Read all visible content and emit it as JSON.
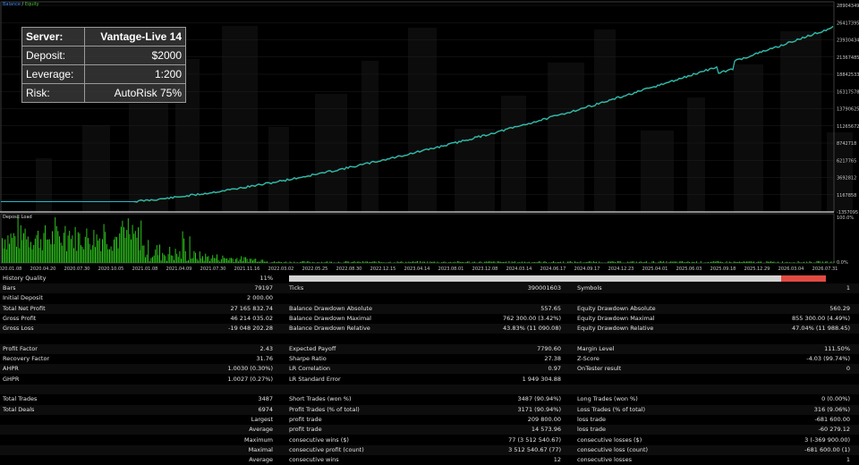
{
  "legend": {
    "balance": "Balance",
    "sep": " / ",
    "equity": "Equity"
  },
  "info_box": {
    "server_label": "Server:",
    "server_value": "Vantage-Live 14",
    "deposit_label": "Deposit:",
    "deposit_value": "$2000",
    "leverage_label": "Leverage:",
    "leverage_value": "1:200",
    "risk_label": "Risk:",
    "risk_value": "AutoRisk 75%"
  },
  "chart": {
    "y_ticks": [
      "28904349",
      "26417395",
      "23930434",
      "21367485",
      "18842533",
      "16317578",
      "13790625",
      "11265672",
      "8742718",
      "6217765",
      "3692812",
      "1167858",
      "-1357095"
    ],
    "load_label": "Deposit Load",
    "load_ticks": [
      "100.0%",
      "0.0%"
    ],
    "x_ticks": [
      "2020.01.08",
      "2020.04.20",
      "2020.07.30",
      "2020.10.05",
      "2021.01.08",
      "2021.04.09",
      "2021.07.30",
      "2021.11.16",
      "2022.03.02",
      "2022.05.25",
      "2022.08.30",
      "2022.12.15",
      "2023.04.14",
      "2023.08.01",
      "2023.12.08",
      "2024.03.14",
      "2024.06.17",
      "2024.09.17",
      "2024.12.23",
      "2025.04.01",
      "2025.06.03",
      "2025.09.18",
      "2025.12.29",
      "2026.03.04",
      "2026.07.31"
    ],
    "colors": {
      "balance": "#3d8cff",
      "equity": "#4bbf3b",
      "load": "#2ec21d",
      "grid": "#1e1e1e",
      "axis": "#c8c8c8"
    }
  },
  "stats": {
    "history_quality_label": "History Quality",
    "history_quality_value": "11%",
    "history_quality_bad_fraction": 0.083,
    "rows": [
      {
        "l1": "Bars",
        "v1": "79197",
        "l2": "Ticks",
        "v2": "390001603",
        "l3": "Symbols",
        "v3": "1"
      },
      {
        "l1": "Initial Deposit",
        "v1": "2 000.00",
        "l2": "",
        "v2": "",
        "l3": "",
        "v3": ""
      },
      {
        "l1": "Total Net Profit",
        "v1": "27 165 832.74",
        "l2": "Balance Drawdown Absolute",
        "v2": "557.65",
        "l3": "Equity Drawdown Absolute",
        "v3": "560.29"
      },
      {
        "l1": "Gross Profit",
        "v1": "46 214 035.02",
        "l2": "Balance Drawdown Maximal",
        "v2": "762 300.00 (3.42%)",
        "l3": "Equity Drawdown Maximal",
        "v3": "855 300.00 (4.49%)"
      },
      {
        "l1": "Gross Loss",
        "v1": "-19 048 202.28",
        "l2": "Balance Drawdown Relative",
        "v2": "43.83% (11 090.08)",
        "l3": "Equity Drawdown Relative",
        "v3": "47.04% (11 988.45)"
      },
      {
        "l1": "",
        "v1": "",
        "l2": "",
        "v2": "",
        "l3": "",
        "v3": ""
      },
      {
        "l1": "Profit Factor",
        "v1": "2.43",
        "l2": "Expected Payoff",
        "v2": "7790.60",
        "l3": "Margin Level",
        "v3": "111.50%"
      },
      {
        "l1": "Recovery Factor",
        "v1": "31.76",
        "l2": "Sharpe Ratio",
        "v2": "27.38",
        "l3": "Z-Score",
        "v3": "-4.03 (99.74%)"
      },
      {
        "l1": "AHPR",
        "v1": "1.0030 (0.30%)",
        "l2": "LR Correlation",
        "v2": "0.97",
        "l3": "OnTester result",
        "v3": "0"
      },
      {
        "l1": "GHPR",
        "v1": "1.0027 (0.27%)",
        "l2": "LR Standard Error",
        "v2": "1 949 304.88",
        "l3": "",
        "v3": ""
      },
      {
        "l1": "",
        "v1": "",
        "l2": "",
        "v2": "",
        "l3": "",
        "v3": ""
      },
      {
        "l1": "Total Trades",
        "v1": "3487",
        "l2": "Short Trades (won %)",
        "v2": "3487 (90.94%)",
        "l3": "Long Trades (won %)",
        "v3": "0 (0.00%)"
      },
      {
        "l1": "Total Deals",
        "v1": "6974",
        "l2": "Profit Trades (% of total)",
        "v2": "3171 (90.94%)",
        "l3": "Loss Trades (% of total)",
        "v3": "316 (9.06%)"
      },
      {
        "l1": "",
        "v1": "Largest",
        "l2": "profit trade",
        "v2": "209 800.00",
        "l3": "loss trade",
        "v3": "-681 600.00"
      },
      {
        "l1": "",
        "v1": "Average",
        "l2": "profit trade",
        "v2": "14 573.96",
        "l3": "loss trade",
        "v3": "-60 279.12"
      },
      {
        "l1": "",
        "v1": "Maximum",
        "l2": "consecutive wins ($)",
        "v2": "77 (3 512 540.67)",
        "l3": "consecutive losses ($)",
        "v3": "3 (-369 900.00)"
      },
      {
        "l1": "",
        "v1": "Maximal",
        "l2": "consecutive profit (count)",
        "v2": "3 512 540.67 (77)",
        "l3": "consecutive loss (count)",
        "v3": "-681 600.00 (1)"
      },
      {
        "l1": "",
        "v1": "Average",
        "l2": "consecutive wins",
        "v2": "12",
        "l3": "consecutive losses",
        "v3": "1"
      }
    ]
  }
}
